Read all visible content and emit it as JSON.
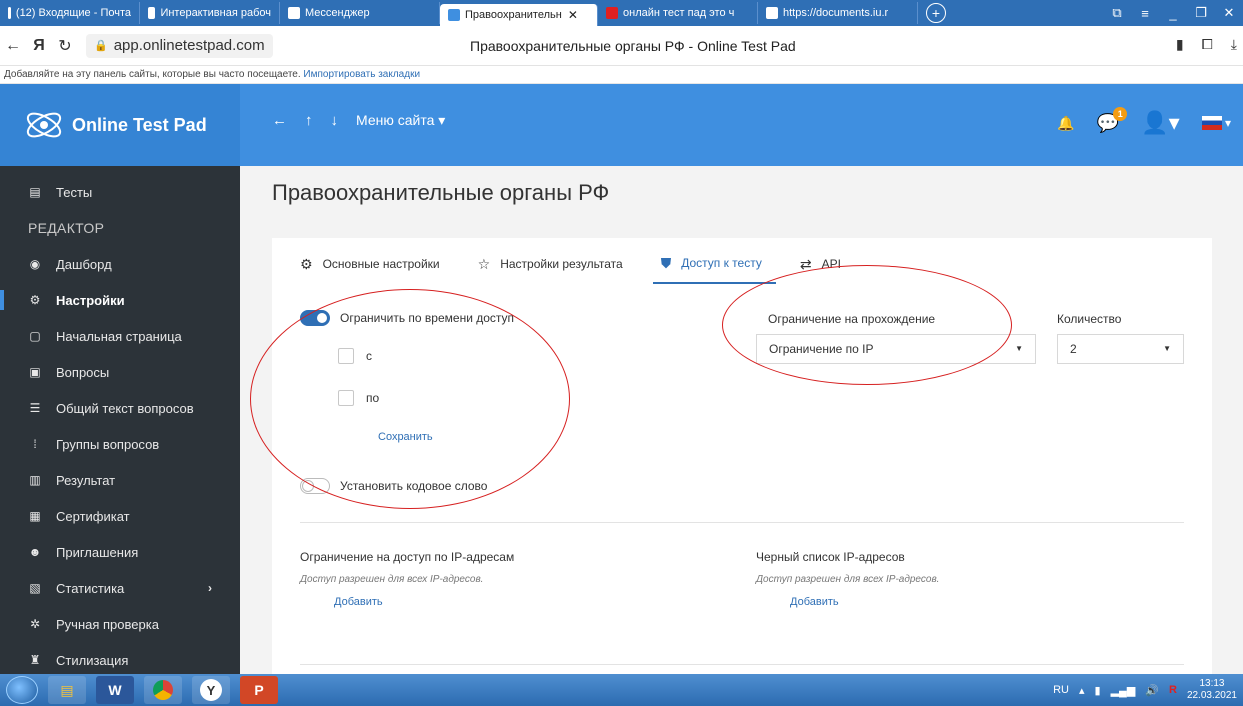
{
  "browser": {
    "tabs": [
      {
        "label": "(12) Входящие - Почта",
        "color": "#2f6fb5",
        "active": false
      },
      {
        "label": "Интерактивная рабоч",
        "color": "#2f6fb5",
        "active": false
      },
      {
        "label": "Мессенджер",
        "color": "#2f6fb5",
        "active": false
      },
      {
        "label": "Правоохранительн",
        "color": "#3f8fe0",
        "active": true
      },
      {
        "label": "онлайн тест пад это ч",
        "color": "#e02020",
        "active": false
      },
      {
        "label": "https://documents.iu.r",
        "color": "#2f6fb5",
        "active": false
      }
    ],
    "url": "app.onlinetestpad.com",
    "page_title": "Правоохранительные органы РФ - Online Test Pad",
    "bookmarks_text": "Добавляйте на эту панель сайты, которые вы часто посещаете.",
    "bookmarks_link": "Импортировать закладки"
  },
  "header": {
    "logo": "Online Test Pad",
    "menu": "Меню сайта",
    "notifications_badge": "1"
  },
  "sidebar": {
    "top_item": "Тесты",
    "section": "РЕДАКТОР",
    "items": [
      "Дашборд",
      "Настройки",
      "Начальная страница",
      "Вопросы",
      "Общий текст вопросов",
      "Группы вопросов",
      "Результат",
      "Сертификат",
      "Приглашения",
      "Статистика",
      "Ручная проверка",
      "Стилизация"
    ],
    "active_index": 1
  },
  "main": {
    "title": "Правоохранительные органы РФ",
    "tabs": [
      "Основные настройки",
      "Настройки результата",
      "Доступ к тесту",
      "API"
    ],
    "active_tab": 2,
    "time_limit": {
      "label": "Ограничить по времени доступ",
      "enabled": true,
      "from_label": "с",
      "to_label": "по",
      "save": "Сохранить"
    },
    "passing_limit": {
      "label": "Ограничение на прохождение",
      "value": "Ограничение по IP"
    },
    "quantity": {
      "label": "Количество",
      "value": "2"
    },
    "code_word": {
      "label": "Установить кодовое слово",
      "enabled": false
    },
    "ip_access": {
      "title": "Ограничение на доступ по IP-адресам",
      "note": "Доступ разрешен для всех IP-адресов.",
      "add": "Добавить"
    },
    "ip_blacklist": {
      "title": "Черный список IP-адресов",
      "note": "Доступ разрешен для всех IP-адресов.",
      "add": "Добавить"
    }
  },
  "taskbar": {
    "lang": "RU",
    "time": "13:13",
    "date": "22.03.2021"
  }
}
